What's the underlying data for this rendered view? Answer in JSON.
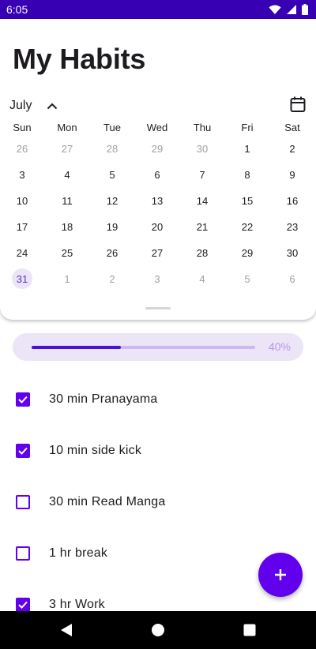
{
  "status_bar": {
    "time": "6:05",
    "background_color": "#3700b3",
    "icons": [
      "wifi-icon",
      "signal-icon",
      "battery-icon"
    ]
  },
  "header": {
    "title": "My Habits"
  },
  "calendar": {
    "month": "July",
    "expanded": true,
    "weekdays": [
      "Sun",
      "Mon",
      "Tue",
      "Wed",
      "Thu",
      "Fri",
      "Sat"
    ],
    "weeks": [
      [
        {
          "day": "26",
          "in_month": false
        },
        {
          "day": "27",
          "in_month": false
        },
        {
          "day": "28",
          "in_month": false
        },
        {
          "day": "29",
          "in_month": false
        },
        {
          "day": "30",
          "in_month": false
        },
        {
          "day": "1",
          "in_month": true
        },
        {
          "day": "2",
          "in_month": true
        }
      ],
      [
        {
          "day": "3",
          "in_month": true
        },
        {
          "day": "4",
          "in_month": true
        },
        {
          "day": "5",
          "in_month": true
        },
        {
          "day": "6",
          "in_month": true
        },
        {
          "day": "7",
          "in_month": true
        },
        {
          "day": "8",
          "in_month": true
        },
        {
          "day": "9",
          "in_month": true
        }
      ],
      [
        {
          "day": "10",
          "in_month": true
        },
        {
          "day": "11",
          "in_month": true
        },
        {
          "day": "12",
          "in_month": true
        },
        {
          "day": "13",
          "in_month": true
        },
        {
          "day": "14",
          "in_month": true
        },
        {
          "day": "15",
          "in_month": true
        },
        {
          "day": "16",
          "in_month": true
        }
      ],
      [
        {
          "day": "17",
          "in_month": true
        },
        {
          "day": "18",
          "in_month": true
        },
        {
          "day": "19",
          "in_month": true
        },
        {
          "day": "20",
          "in_month": true
        },
        {
          "day": "21",
          "in_month": true
        },
        {
          "day": "22",
          "in_month": true
        },
        {
          "day": "23",
          "in_month": true
        }
      ],
      [
        {
          "day": "24",
          "in_month": true
        },
        {
          "day": "25",
          "in_month": true
        },
        {
          "day": "26",
          "in_month": true
        },
        {
          "day": "27",
          "in_month": true
        },
        {
          "day": "28",
          "in_month": true
        },
        {
          "day": "29",
          "in_month": true
        },
        {
          "day": "30",
          "in_month": true
        }
      ],
      [
        {
          "day": "31",
          "in_month": true,
          "selected": true
        },
        {
          "day": "1",
          "in_month": false
        },
        {
          "day": "2",
          "in_month": false
        },
        {
          "day": "3",
          "in_month": false
        },
        {
          "day": "4",
          "in_month": false
        },
        {
          "day": "5",
          "in_month": false
        },
        {
          "day": "6",
          "in_month": false
        }
      ]
    ]
  },
  "progress": {
    "fraction": 0.4,
    "label": "40%"
  },
  "habits": [
    {
      "label": "30 min Pranayama",
      "checked": true
    },
    {
      "label": "10 min side kick",
      "checked": true
    },
    {
      "label": "30 min Read Manga",
      "checked": false
    },
    {
      "label": "1 hr break",
      "checked": false
    },
    {
      "label": "3 hr Work",
      "checked": true
    }
  ],
  "fab": {
    "icon": "plus-icon",
    "color": "#6200ee"
  },
  "nav_bar": {
    "buttons": [
      "back-icon",
      "home-icon",
      "recents-icon"
    ]
  }
}
